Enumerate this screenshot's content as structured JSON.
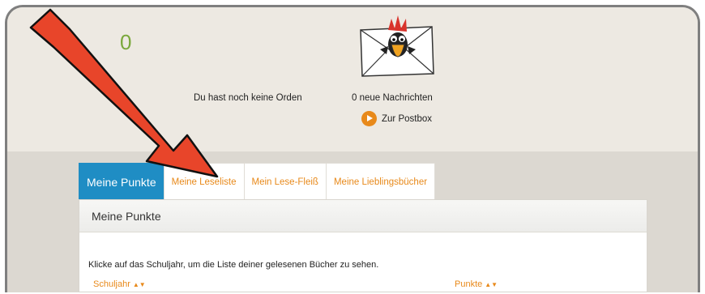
{
  "profile": {
    "points": "0",
    "orden_text": "Du hast noch keine Orden",
    "messages_text": "0 neue Nachrichten",
    "postbox_link": "Zur Postbox"
  },
  "tabs": [
    {
      "label": "Meine Punkte",
      "active": true
    },
    {
      "label": "Meine Leseliste",
      "active": false
    },
    {
      "label": "Mein Lese-Fleiß",
      "active": false
    },
    {
      "label": "Meine Lieblingsbücher",
      "active": false
    }
  ],
  "panel": {
    "title": "Meine Punkte",
    "instruction": "Klicke auf das Schuljahr, um die Liste deiner gelesenen Bücher zu sehen.",
    "columns": [
      {
        "label": "Schuljahr",
        "sort_icon": "sort-icon"
      },
      {
        "label": "Punkte",
        "sort_icon": "sort-icon"
      }
    ]
  },
  "annotation": {
    "arrow_color": "#e8452a",
    "target": "Meine Leseliste tab"
  },
  "colors": {
    "accent": "#e8891a",
    "active_tab": "#1f8dc4",
    "points": "#7aa83c"
  }
}
